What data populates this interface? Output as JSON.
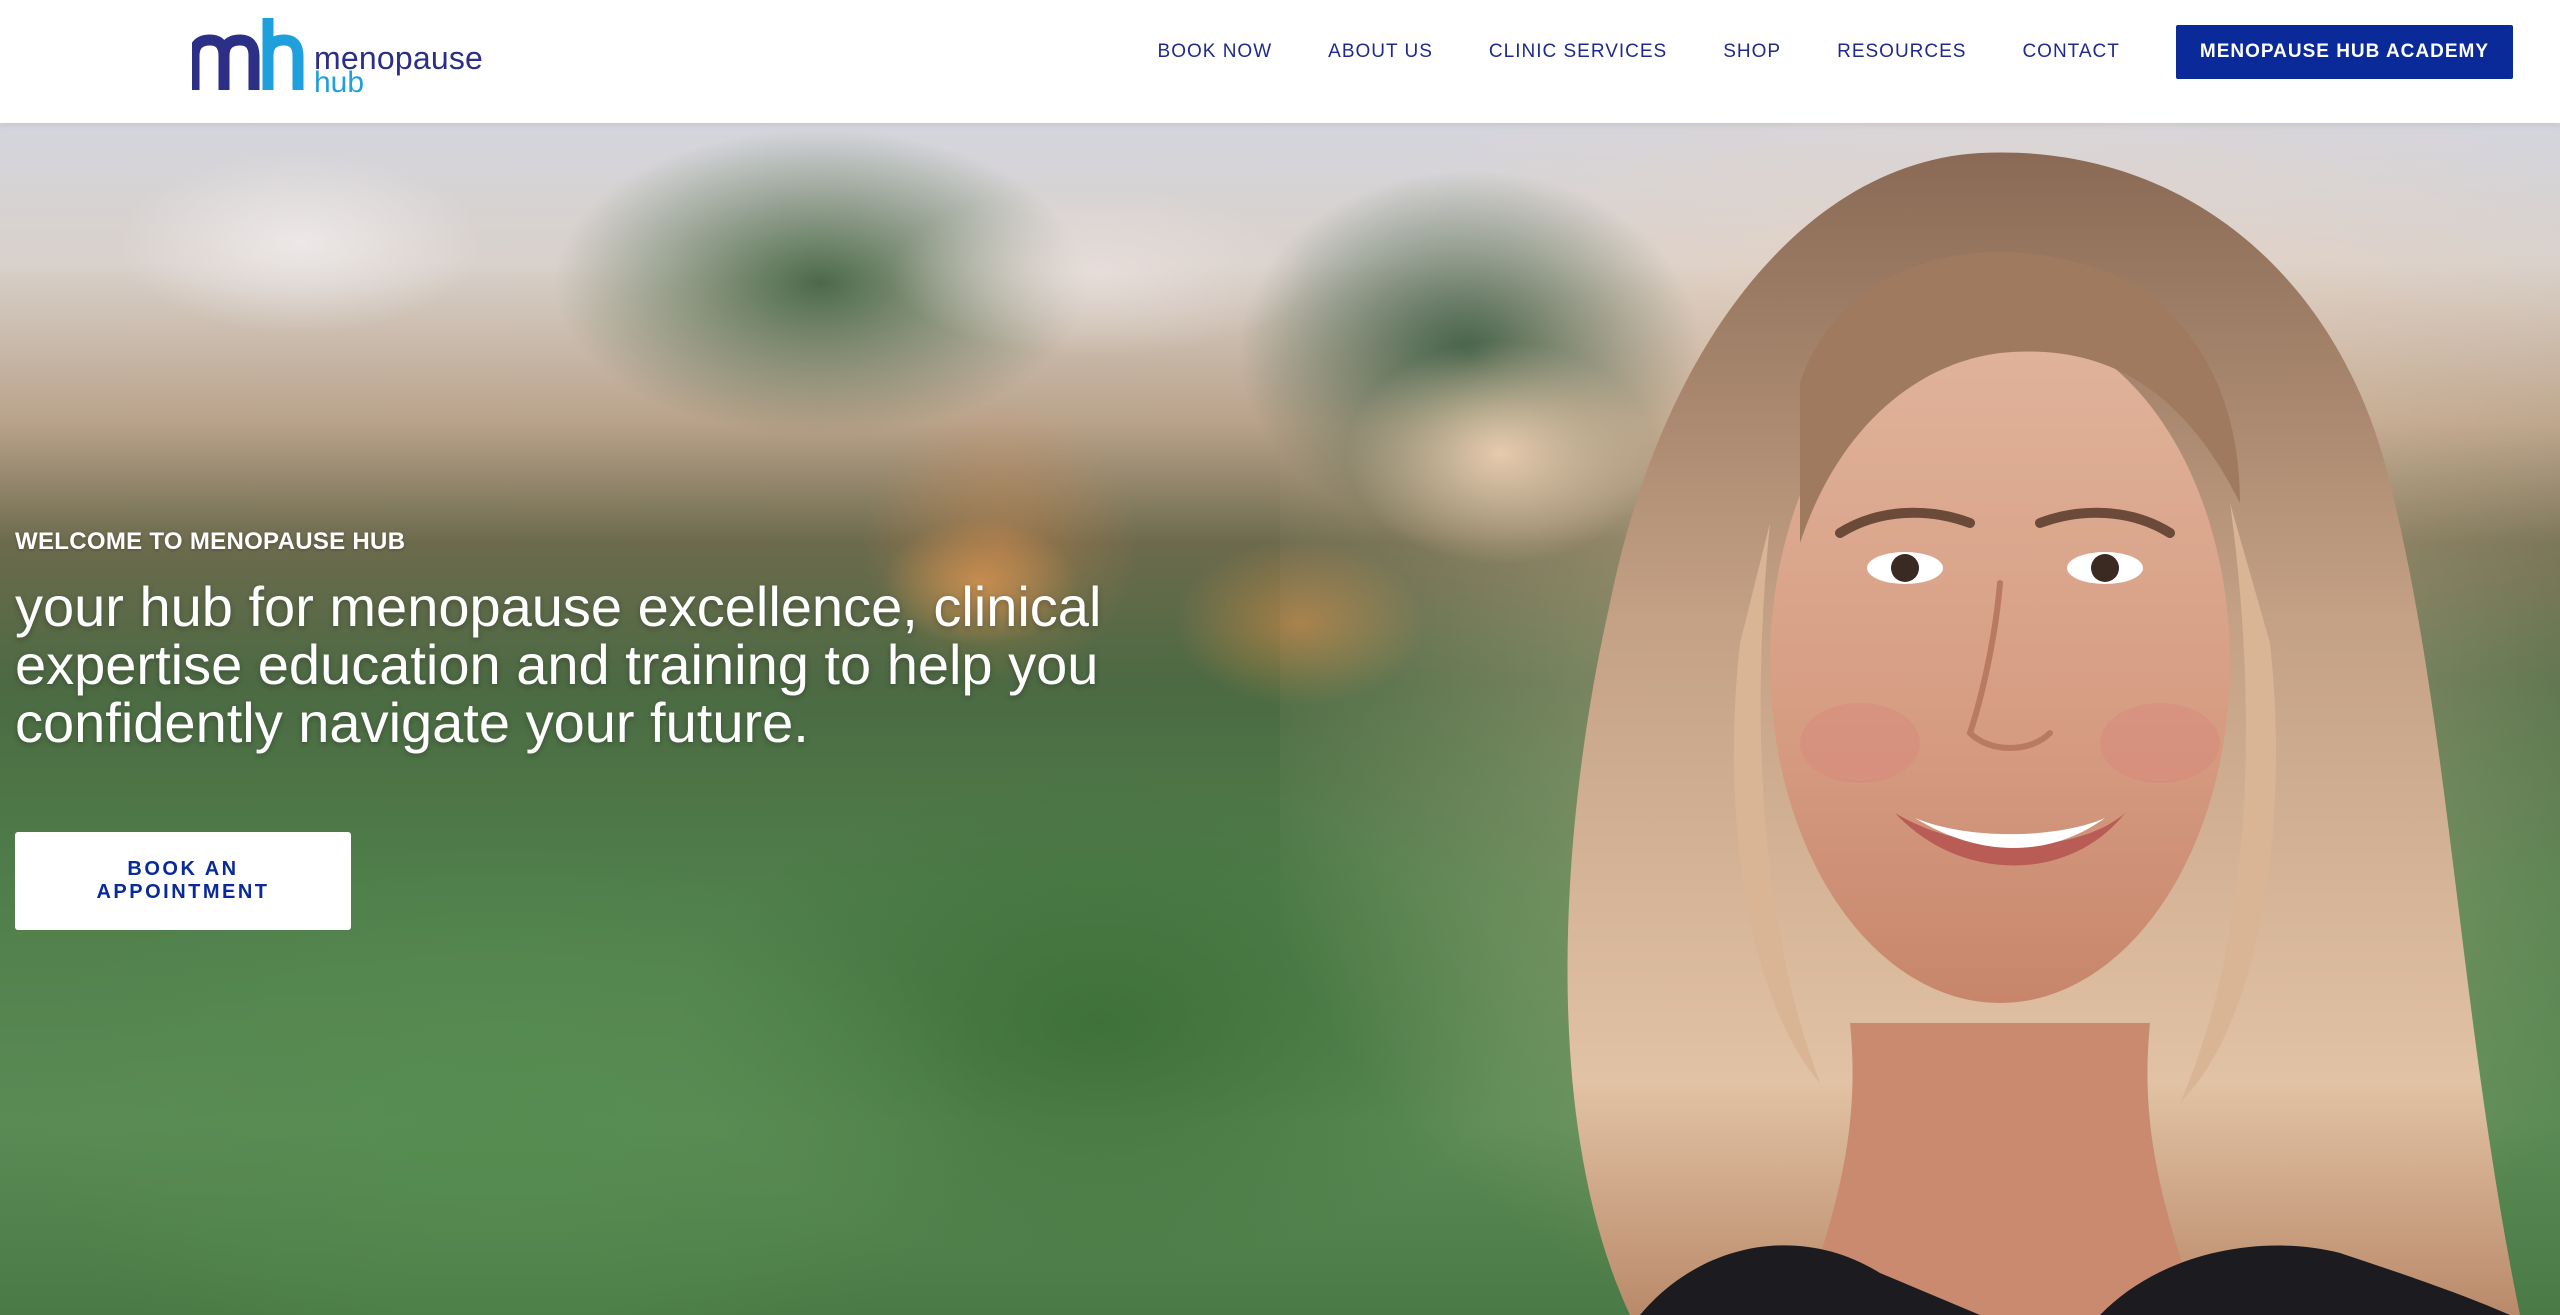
{
  "brand": {
    "name_line_1": "menopause",
    "name_line_2": "hub",
    "colors": {
      "primary": "#2b2f86",
      "accent": "#1fa0dc",
      "cta": "#0a2a9a"
    }
  },
  "nav": {
    "items": [
      {
        "label": "BOOK NOW"
      },
      {
        "label": "ABOUT US"
      },
      {
        "label": "CLINIC SERVICES"
      },
      {
        "label": "SHOP"
      },
      {
        "label": "RESOURCES"
      },
      {
        "label": "CONTACT"
      }
    ],
    "cta_label": "MENOPAUSE HUB ACADEMY"
  },
  "hero": {
    "eyebrow": "WELCOME TO MENOPAUSE HUB",
    "headline": "your hub for menopause excellence, clinical expertise education and training to help you confidently navigate your future.",
    "button_label": "BOOK AN APPOINTMENT"
  }
}
